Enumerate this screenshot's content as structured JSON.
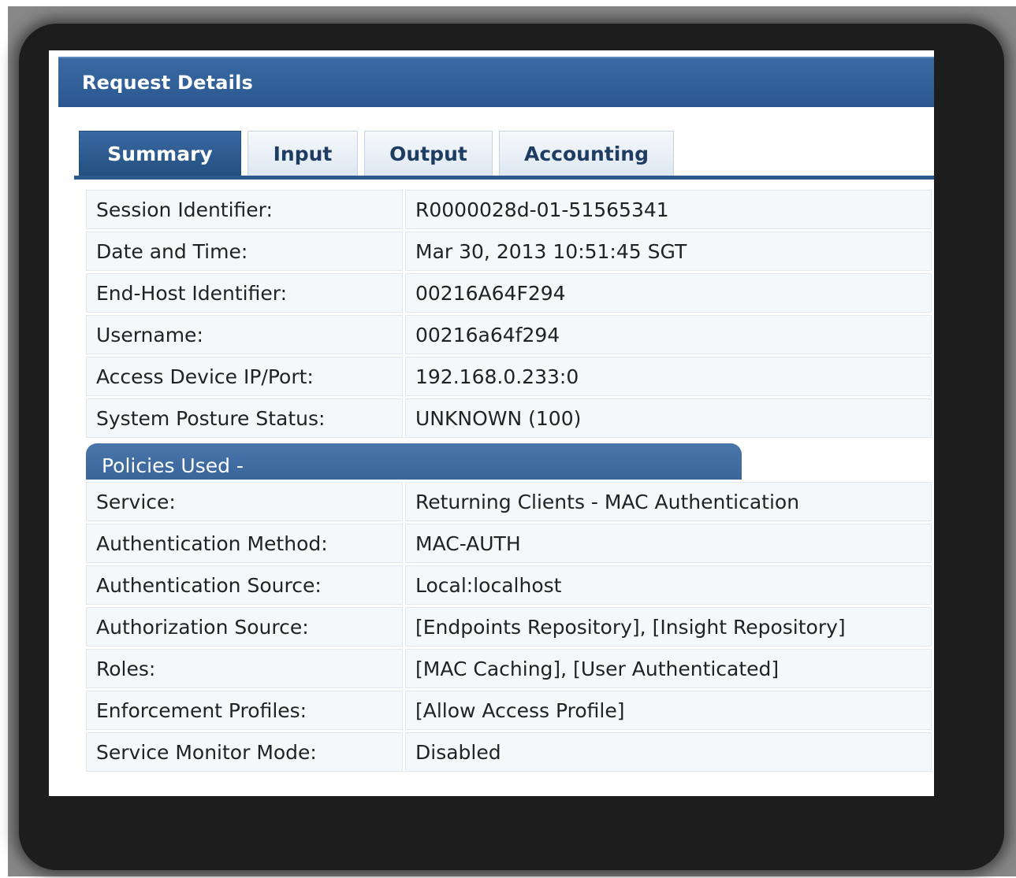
{
  "dialog": {
    "title": "Request Details"
  },
  "tabs": [
    {
      "label": "Summary",
      "active": true
    },
    {
      "label": "Input",
      "active": false
    },
    {
      "label": "Output",
      "active": false
    },
    {
      "label": "Accounting",
      "active": false
    }
  ],
  "summary": {
    "rows": [
      {
        "label": "Session Identifier:",
        "value": "R0000028d-01-51565341"
      },
      {
        "label": "Date and Time:",
        "value": "Mar 30, 2013 10:51:45 SGT"
      },
      {
        "label": "End-Host Identifier:",
        "value": "00216A64F294"
      },
      {
        "label": "Username:",
        "value": "00216a64f294"
      },
      {
        "label": "Access Device IP/Port:",
        "value": "192.168.0.233:0"
      },
      {
        "label": "System Posture Status:",
        "value": "UNKNOWN (100)"
      }
    ]
  },
  "policies": {
    "header": "Policies Used -",
    "rows": [
      {
        "label": "Service:",
        "value": "Returning Clients - MAC Authentication"
      },
      {
        "label": "Authentication Method:",
        "value": "MAC-AUTH"
      },
      {
        "label": "Authentication Source:",
        "value": "Local:localhost"
      },
      {
        "label": "Authorization Source:",
        "value": "[Endpoints Repository], [Insight Repository]"
      },
      {
        "label": "Roles:",
        "value": "[MAC Caching], [User Authenticated]"
      },
      {
        "label": "Enforcement Profiles:",
        "value": "[Allow Access Profile]"
      },
      {
        "label": "Service Monitor Mode:",
        "value": "Disabled"
      }
    ]
  },
  "colors": {
    "header_blue": "#2a5790",
    "tab_active": "#24507f",
    "row_background": "#f5f8fb"
  },
  "icons": {
    "side_strip": "collapse-arrow-icon"
  }
}
